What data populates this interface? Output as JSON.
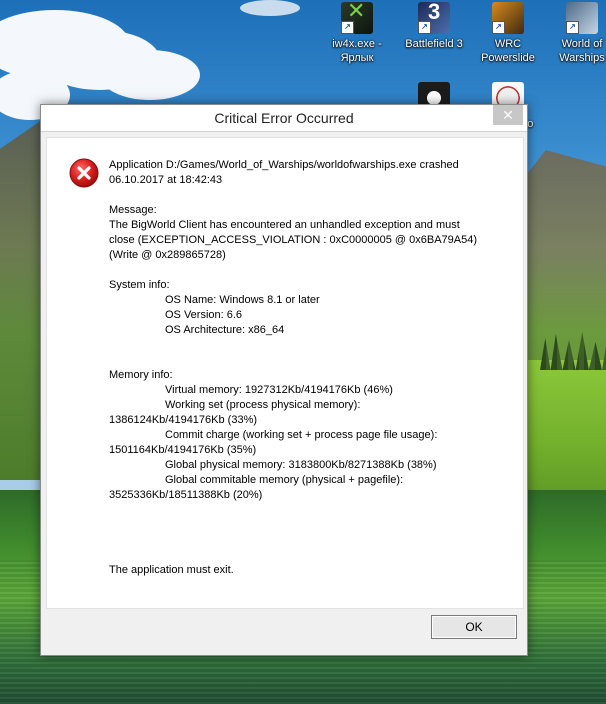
{
  "desktop": {
    "icons": [
      {
        "label": "iw4x.exe -\nЯрлык",
        "icon": "iw4x-icon"
      },
      {
        "label": "Battlefield 3",
        "icon": "battlefield3-icon"
      },
      {
        "label": "WRC\nPowerslide",
        "icon": "wrc-icon"
      },
      {
        "label": "World of\nWarships",
        "icon": "world-of-warships-icon"
      },
      {
        "label": "",
        "icon": "p3-icon"
      },
      {
        "label": "Goo",
        "icon": "goo-icon"
      }
    ]
  },
  "dialog": {
    "title": "Critical Error Occurred",
    "close_glyph": "✕",
    "error_icon": "error-icon",
    "header_line1": "Application D:/Games/World_of_Warships/worldofwarships.exe crashed",
    "header_line2": "06.10.2017 at 18:42:43",
    "message_label": "Message:",
    "message_line1": "The BigWorld Client has encountered an unhandled exception and must",
    "message_line2": "close (EXCEPTION_ACCESS_VIOLATION : 0xC0000005 @ 0x6BA79A54)",
    "message_line3": "(Write @ 0x289865728)",
    "system_label": "System info:",
    "os_name": "OS Name: Windows 8.1 or later",
    "os_version": "OS Version: 6.6",
    "os_arch": "OS Architecture: x86_64",
    "memory_label": "Memory info:",
    "virtual_memory": "Virtual memory: 1927312Kb/4194176Kb (46%)",
    "working_set_1": "Working set (process physical memory):",
    "working_set_2": "1386124Kb/4194176Kb (33%)",
    "commit_1": "Commit charge (working set + process page file usage):",
    "commit_2": "1501164Kb/4194176Kb (35%)",
    "global_physical": "Global physical memory: 3183800Kb/8271388Kb (38%)",
    "global_commit_1": "Global commitable memory (physical + pagefile):",
    "global_commit_2": "3525336Kb/18511388Kb (20%)",
    "exit_text": "The application must exit.",
    "ok_label": "OK"
  }
}
